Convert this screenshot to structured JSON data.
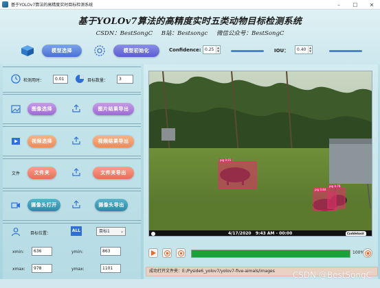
{
  "window": {
    "title": "基于YOLOv7算法的高精度实时目标检测系统",
    "minimize": "–",
    "maximize": "☐",
    "close": "✕"
  },
  "header": {
    "title": "基于YOLOv7算法的高精度实时五类动物目标检测系统",
    "csdn": "CSDN：BestSongC",
    "bilibili": "B站：Bestsongc",
    "wechat": "微信公众号：BestSongC"
  },
  "toolbar": {
    "model_select_label": "模型选择",
    "model_init_label": "模型初始化",
    "confidence_label": "Confidence:",
    "confidence_value": "0.25",
    "iou_label": "IOU：",
    "iou_value": "0.40"
  },
  "stats": {
    "time_label": "检测用时：",
    "time_value": "0.01",
    "count_label": "目标数量：",
    "count_value": "3"
  },
  "image_section": {
    "select_label": "图像选择",
    "export_label": "图片结果导出"
  },
  "video_section": {
    "open_label": "视频选择",
    "export_label": "视频结果导出"
  },
  "folder_section": {
    "row_label": "文件",
    "open_label": "文件夹",
    "export_label": "文件夹导出"
  },
  "camera_section": {
    "open_label": "摄像头打开",
    "export_label": "摄像头导出"
  },
  "target": {
    "position_label": "目标位置：",
    "all_label": "ALL",
    "selected_target": "目标1",
    "xmin_label": "xmin:",
    "xmin_value": "636",
    "ymin_label": "ymin:",
    "ymin_value": "863",
    "xmax_label": "xmax:",
    "xmax_value": "978",
    "ymax_label": "ymax:",
    "ymax_value": "1101"
  },
  "video": {
    "timestamp": "4/17/2020   9:43 AM - 00:00",
    "camera_brand": "Cuddeback",
    "detections": [
      {
        "label": "pig 0.91",
        "color": "#e0306a"
      },
      {
        "label": "pig 0.84",
        "color": "#e0306a"
      },
      {
        "label": "pig 0.78",
        "color": "#e0306a"
      }
    ]
  },
  "playback": {
    "progress_percent": 100,
    "progress_label": "100%"
  },
  "status": {
    "text": "成功打开文件夹：E:/Pyside6_yolov7/yolov7-five-aimals/images"
  },
  "watermark": "CSDN @BestSongC",
  "colors": {
    "accent_blue": "#4b6fd6",
    "accent_orange": "#ee8a57",
    "accent_teal": "#2f87a7",
    "progress_green": "#18a33a",
    "detection_box": "#e0306a"
  }
}
